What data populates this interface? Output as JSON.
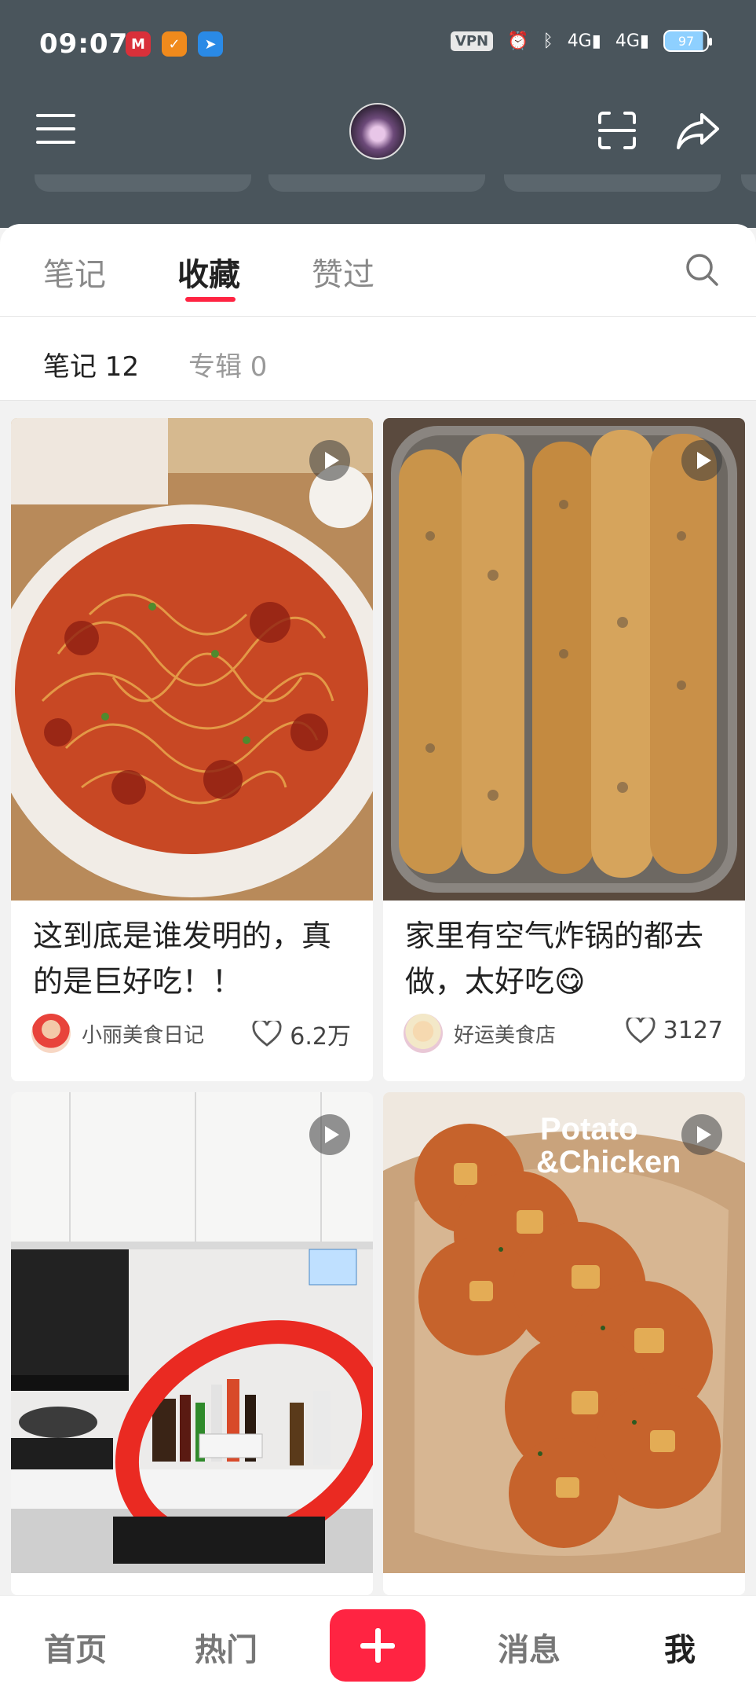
{
  "status_bar": {
    "time": "09:07",
    "vpn": "VPN",
    "net1": "4G",
    "net2": "4G",
    "battery": "97"
  },
  "header": {
    "icons": [
      "menu-icon",
      "avatar",
      "scan-icon",
      "share-icon"
    ]
  },
  "tabs": [
    {
      "label": "笔记"
    },
    {
      "label": "收藏",
      "active": true
    },
    {
      "label": "赞过"
    }
  ],
  "subtabs": [
    {
      "label": "笔记 12",
      "active": true
    },
    {
      "label": "专辑 0"
    }
  ],
  "cards": [
    {
      "title": "这到底是谁发明的，真的是巨好吃！！",
      "author": "小丽美食日记",
      "likes": "6.2万",
      "video": true
    },
    {
      "title": "家里有空气炸锅的都去做，太好吃😋",
      "author": "好运美食店",
      "likes": "3127",
      "video": true
    },
    {
      "title": "",
      "author": "",
      "likes": "",
      "video": true
    },
    {
      "title": "",
      "overlay_text": "Potato &Chicken",
      "author": "",
      "likes": "",
      "video": true
    }
  ],
  "nav": {
    "home": "首页",
    "hot": "热门",
    "messages": "消息",
    "me": "我"
  },
  "colors": {
    "accent": "#ff2442",
    "header_bg": "#4a555c"
  }
}
